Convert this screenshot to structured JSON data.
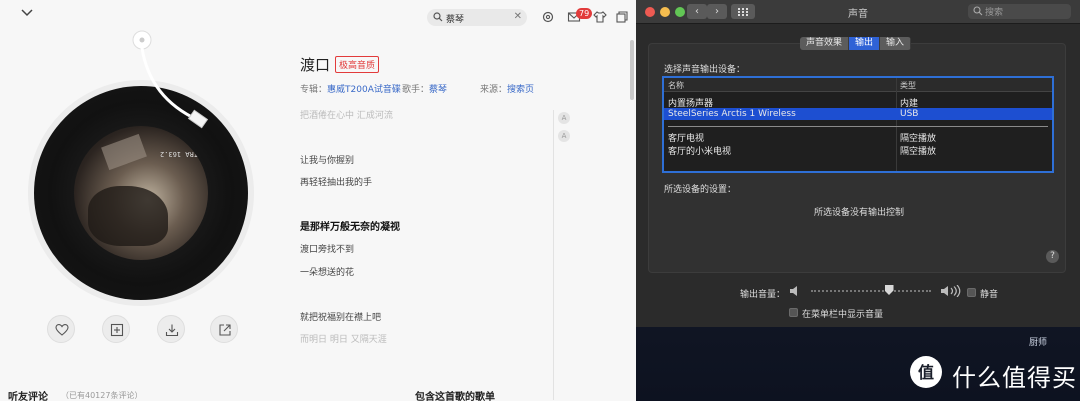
{
  "player": {
    "search_query": "蔡琴",
    "mail_badge": "79",
    "song": {
      "title": "渡口",
      "quality_badge": "极高音质",
      "album_label": "专辑：",
      "album": "惠威T200A试音碟",
      "singer_label": "歌手：",
      "singer": "蔡琴",
      "source_label": "来源：",
      "source": "搜索页"
    },
    "lyrics": [
      {
        "text": "把酒倦在心中 汇成河流",
        "state": "dim"
      },
      {
        "text": "让我与你握别",
        "state": "normal"
      },
      {
        "text": "再轻轻抽出我的手",
        "state": "normal"
      },
      {
        "text": "是那样万般无奈的凝视",
        "state": "current"
      },
      {
        "text": "渡口旁找不到",
        "state": "normal"
      },
      {
        "text": "一朵想送的花",
        "state": "normal"
      },
      {
        "text": "就把祝福别在襟上吧",
        "state": "normal"
      },
      {
        "text": "而明日 明日 又隔天涯",
        "state": "dim"
      }
    ],
    "side_buttons": [
      "A",
      "A"
    ],
    "sections": {
      "comments_title": "听友评论",
      "comments_count": "（已有40127条评论）",
      "playlists_title": "包含这首歌的歌单"
    },
    "disc_caption": "IRA 163.2"
  },
  "prefs": {
    "window_title": "声音",
    "search_placeholder": "搜索",
    "tabs": [
      {
        "label": "声音效果",
        "active": false
      },
      {
        "label": "输出",
        "active": true
      },
      {
        "label": "输入",
        "active": false
      }
    ],
    "select_label": "选择声音输出设备：",
    "columns": [
      "名称",
      "类型"
    ],
    "devices_group1": [
      {
        "name": "内置扬声器",
        "type": "内建",
        "selected": false
      },
      {
        "name": "SteelSeries Arctis 1 Wireless",
        "type": "USB",
        "selected": true
      }
    ],
    "devices_group2": [
      {
        "name": "客厅电视",
        "type": "隔空播放",
        "selected": false
      },
      {
        "name": "客厅的小米电视",
        "type": "隔空播放",
        "selected": false
      }
    ],
    "settings_label": "所选设备的设置：",
    "no_controls": "所选设备没有输出控制",
    "help": "?",
    "volume_label": "输出音量：",
    "volume_level": 0.65,
    "mute_label": "静音",
    "menubar_label": "在菜单栏中显示音量",
    "colors": {
      "accent": "#2e6fd6",
      "selection": "#1d4fd1"
    }
  },
  "desktop": {
    "dock_label": "厨师",
    "brand": "什么值得买",
    "brand_mark": "值"
  }
}
